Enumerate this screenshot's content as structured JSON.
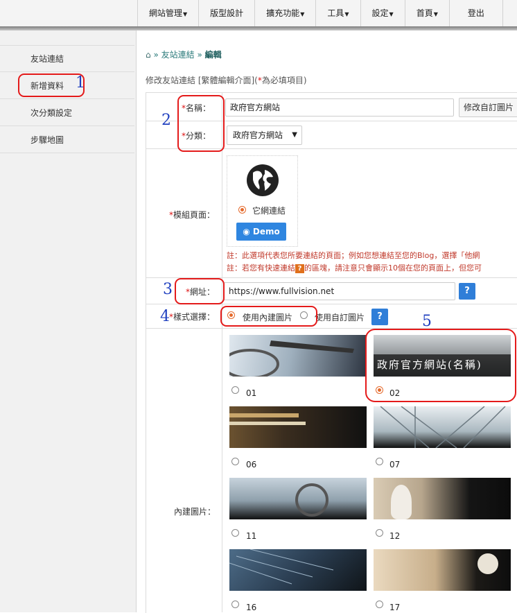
{
  "nav": {
    "items": [
      {
        "label": "網站管理",
        "caret": true
      },
      {
        "label": "版型設計",
        "caret": false
      },
      {
        "label": "擴充功能",
        "caret": true
      },
      {
        "label": "工具",
        "caret": true
      },
      {
        "label": "設定",
        "caret": true
      },
      {
        "label": "首頁",
        "caret": true
      },
      {
        "label": "登出",
        "caret": false
      }
    ]
  },
  "sidebar": {
    "items": [
      {
        "label": "友站連結"
      },
      {
        "label": "新增資料"
      },
      {
        "label": "次分類設定"
      },
      {
        "label": "步驟地圖"
      }
    ]
  },
  "breadcrumb": {
    "home_icon": "home-icon",
    "sep": "»",
    "parent": "友站連結",
    "current": "編輯"
  },
  "form": {
    "title_prefix": "修改友站連結 [繁體編輯介面](",
    "title_star": "*",
    "title_suffix": "為必填項目)",
    "star": "*",
    "name_label": "名稱：",
    "name_value": "政府官方網站",
    "custom_image_button": "修改自訂圖片",
    "category_label": "分類：",
    "category_value": "政府官方網站",
    "module_label": "模組頁面：",
    "module_option": "它網連結",
    "demo_button": "Demo",
    "note1": "註：此選項代表您所要連結的頁面；例如您想連結至您的Blog，選擇「他網",
    "note2_a": "註：若您有快速連結",
    "note2_q": "?",
    "note2_b": "的區塊，請注意只會顯示10個在您的頁面上，但您可",
    "url_label": "網址：",
    "url_value": "https://www.fullvision.net",
    "help_q": "?",
    "style_label": "樣式選擇：",
    "style_builtin": "使用內建圖片",
    "style_custom": "使用自訂圖片",
    "builtin_label": "內建圖片：",
    "banner_text": "政府官方網站(名稱)"
  },
  "images": [
    {
      "label": "01",
      "selected": false
    },
    {
      "label": "02",
      "selected": true
    },
    {
      "label": "06",
      "selected": false
    },
    {
      "label": "07",
      "selected": false
    },
    {
      "label": "11",
      "selected": false
    },
    {
      "label": "12",
      "selected": false
    },
    {
      "label": "16",
      "selected": false
    },
    {
      "label": "17",
      "selected": false
    }
  ],
  "annotations": [
    "1",
    "2",
    "3",
    "4",
    "5"
  ],
  "colors": {
    "accent": "#2f86e0",
    "required": "#d11111",
    "annotation": "#e41a1a",
    "number": "#1f3fbf"
  }
}
